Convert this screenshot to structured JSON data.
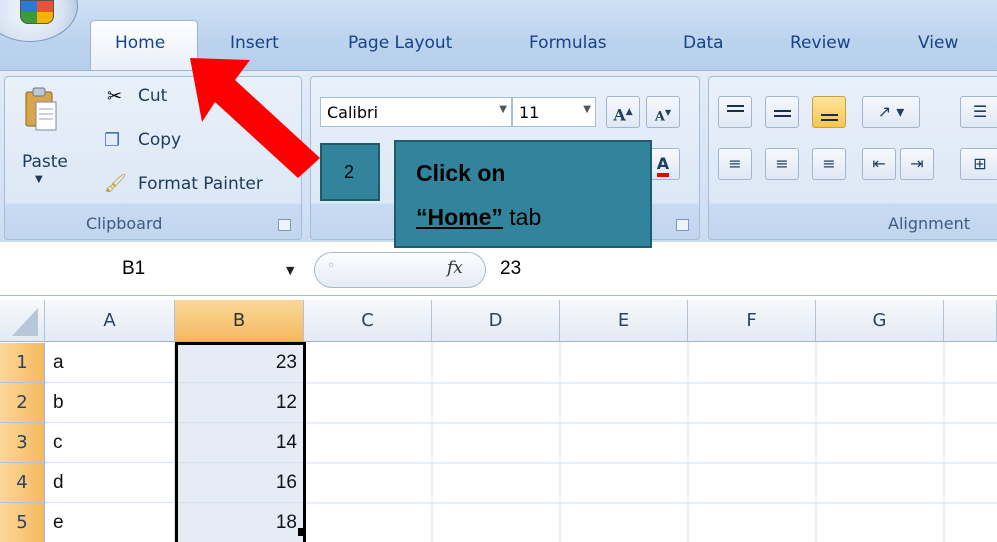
{
  "ribbon": {
    "tabs": [
      "Home",
      "Insert",
      "Page Layout",
      "Formulas",
      "Data",
      "Review",
      "View"
    ],
    "active_tab": "Home",
    "clipboard": {
      "paste_label": "Paste",
      "cut_label": "Cut",
      "copy_label": "Copy",
      "format_painter_label": "Format Painter",
      "group_label": "Clipboard"
    },
    "font": {
      "font_name": "Calibri",
      "font_size": "11"
    },
    "alignment": {
      "group_label": "Alignment"
    }
  },
  "formula_bar": {
    "name_box": "B1",
    "fx_label": "fx",
    "value": "23"
  },
  "sheet": {
    "columns": [
      "A",
      "B",
      "C",
      "D",
      "E",
      "F",
      "G"
    ],
    "selected_column": "B",
    "rows": [
      {
        "num": "1",
        "a": "a",
        "b": "23"
      },
      {
        "num": "2",
        "a": "b",
        "b": "12"
      },
      {
        "num": "3",
        "a": "c",
        "b": "14"
      },
      {
        "num": "4",
        "a": "d",
        "b": "16"
      },
      {
        "num": "5",
        "a": "e",
        "b": "18"
      }
    ]
  },
  "tutorial": {
    "step_number": "2",
    "callout_line1": "Click on",
    "callout_home": "“Home”",
    "callout_tab": " tab",
    "arrow_color": "#ff0000",
    "callout_color": "#31849b"
  }
}
